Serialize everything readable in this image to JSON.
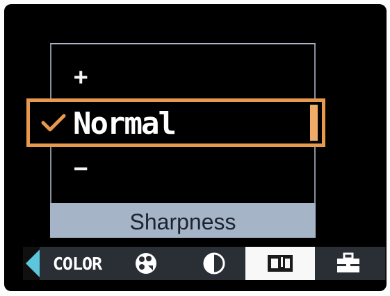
{
  "menu": {
    "title": "Sharpness",
    "options": {
      "plus": "+",
      "selected": "Normal",
      "minus": "−"
    }
  },
  "tabs": [
    {
      "id": "color",
      "label": "COLOR",
      "icon": "color-text"
    },
    {
      "id": "filter",
      "label": "",
      "icon": "palette-icon"
    },
    {
      "id": "contrast",
      "label": "",
      "icon": "contrast-icon"
    },
    {
      "id": "sharpness",
      "label": "",
      "icon": "sharpness-icon",
      "active": true
    },
    {
      "id": "setup",
      "label": "",
      "icon": "toolbox-icon"
    }
  ],
  "colors": {
    "highlight": "#e79a4e",
    "title_bar": "#a5b5c7",
    "screen": "#000000",
    "active_tab": "#f8f8f8",
    "arrow": "#5ec6dc"
  }
}
